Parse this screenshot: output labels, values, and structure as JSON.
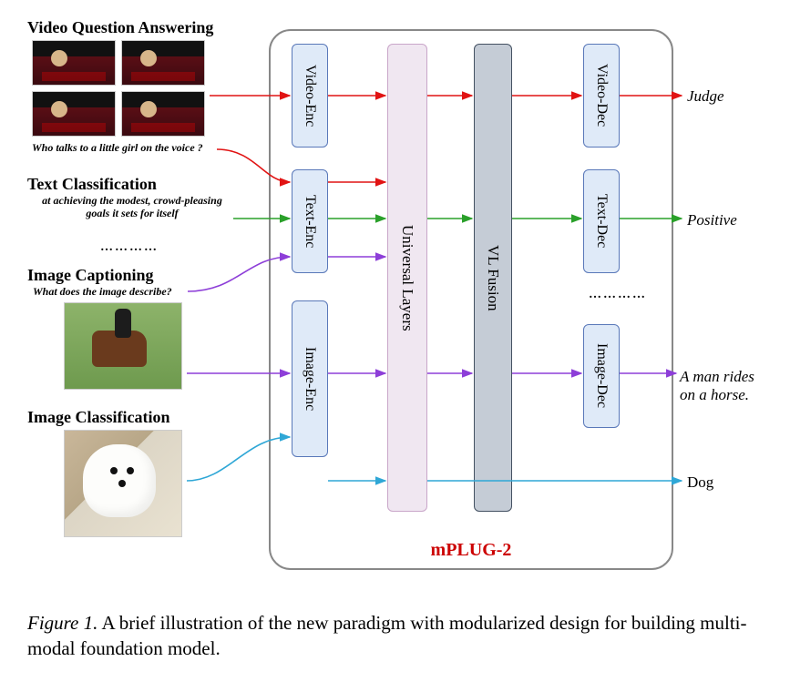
{
  "tasks": {
    "vqa": {
      "title": "Video Question Answering",
      "question": "Who talks to a little girl on the voice ?",
      "output": "Judge"
    },
    "textcls": {
      "title": "Text Classification",
      "sample": "at achieving the modest, crowd-pleasing goals it sets for itself",
      "output": "Positive"
    },
    "imgcap": {
      "title": "Image Captioning",
      "prompt": "What does the image describe?",
      "output": "A man rides on a horse."
    },
    "imgcls": {
      "title": "Image Classification",
      "output": "Dog"
    }
  },
  "modules": {
    "video_enc": "Video-Enc",
    "text_enc": "Text-Enc",
    "image_enc": "Image-Enc",
    "universal": "Universal Layers",
    "vl_fusion": "VL Fusion",
    "video_dec": "Video-Dec",
    "text_dec": "Text-Dec",
    "image_dec": "Image-Dec"
  },
  "dots_left": "…………",
  "dots_right": "…………",
  "panel_label": "mPLUG-2",
  "caption": {
    "label": "Figure 1.",
    "text": " A brief illustration of the new paradigm with modularized design for building multi-modal foundation model."
  },
  "colors": {
    "vqa": "#e11313",
    "textcls": "#2aa02a",
    "imgcap": "#8d3ed8",
    "imgcls": "#2fa7d6"
  }
}
